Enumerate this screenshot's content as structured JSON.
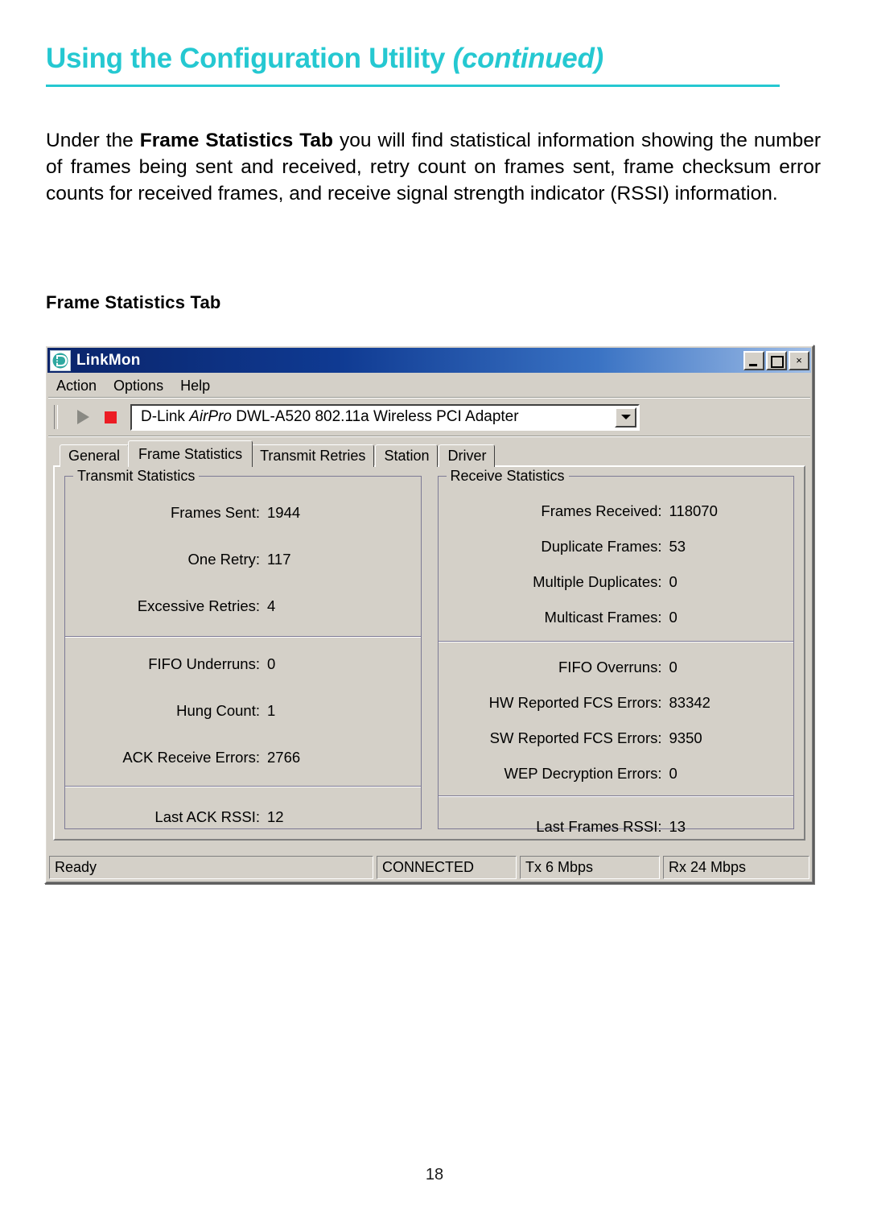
{
  "page": {
    "heading_main": "Using the Configuration Utility",
    "heading_suffix": "(continued)",
    "heading_color": "#25c8d1",
    "intro_before": "Under the ",
    "intro_bold": "Frame Statistics Tab",
    "intro_after": " you will find statistical information showing the number of frames being sent and received, retry count on frames sent, frame checksum error counts for received frames, and receive signal strength indicator (RSSI) information.",
    "section_title": "Frame Statistics Tab",
    "page_number": "18"
  },
  "window": {
    "title": "LinkMon",
    "icon": "dlink-logo-icon",
    "buttons": {
      "minimize": "minimize-icon",
      "maximize": "maximize-icon",
      "close": "×"
    },
    "menu": [
      "Action",
      "Options",
      "Help"
    ],
    "toolbar": {
      "play": "play-icon",
      "stop": "stop-icon",
      "adapter_prefix": "D-Link ",
      "adapter_italic": "AirPro",
      "adapter_suffix": " DWL-A520 802.11a Wireless PCI Adapter",
      "dropdown_arrow": "chevron-down-icon"
    },
    "tabs": [
      {
        "label": "General",
        "active": false
      },
      {
        "label": "Frame Statistics",
        "active": true
      },
      {
        "label": "Transmit Retries",
        "active": false
      },
      {
        "label": "Station",
        "active": false
      },
      {
        "label": "Driver",
        "active": false
      }
    ],
    "transmit": {
      "title": "Transmit Statistics",
      "group1": [
        {
          "label": "Frames Sent:",
          "value": "1944"
        },
        {
          "label": "One Retry:",
          "value": "117"
        },
        {
          "label": "Excessive Retries:",
          "value": "4"
        }
      ],
      "group2": [
        {
          "label": "FIFO Underruns:",
          "value": "0"
        },
        {
          "label": "Hung Count:",
          "value": "1"
        },
        {
          "label": "ACK Receive Errors:",
          "value": "2766"
        }
      ],
      "group3": [
        {
          "label": "Last ACK RSSI:",
          "value": "12"
        }
      ]
    },
    "receive": {
      "title": "Receive Statistics",
      "group1": [
        {
          "label": "Frames Received:",
          "value": "118070"
        },
        {
          "label": "Duplicate Frames:",
          "value": "53"
        },
        {
          "label": "Multiple Duplicates:",
          "value": "0"
        },
        {
          "label": "Multicast Frames:",
          "value": "0"
        }
      ],
      "group2": [
        {
          "label": "FIFO Overruns:",
          "value": "0"
        },
        {
          "label": "HW Reported FCS Errors:",
          "value": "83342"
        },
        {
          "label": "SW Reported FCS Errors:",
          "value": "9350"
        },
        {
          "label": "WEP Decryption Errors:",
          "value": "0"
        }
      ],
      "group3": [
        {
          "label": "Last Frames RSSI:",
          "value": "13"
        }
      ]
    },
    "statusbar": {
      "ready": "Ready",
      "connection": "CONNECTED",
      "tx": "Tx 6 Mbps",
      "rx": "Rx 24 Mbps"
    }
  }
}
